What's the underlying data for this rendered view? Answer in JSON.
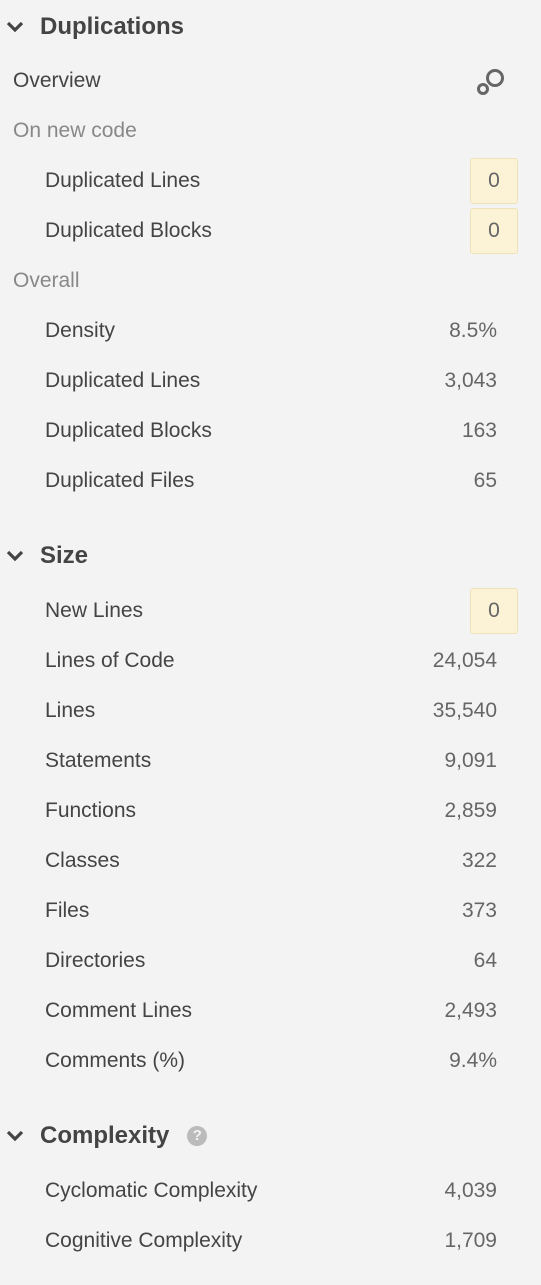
{
  "duplications": {
    "title": "Duplications",
    "overview": "Overview",
    "on_new_code": "On new code",
    "new_items": [
      {
        "label": "Duplicated Lines",
        "value": "0"
      },
      {
        "label": "Duplicated Blocks",
        "value": "0"
      }
    ],
    "overall": "Overall",
    "overall_items": [
      {
        "label": "Density",
        "value": "8.5%"
      },
      {
        "label": "Duplicated Lines",
        "value": "3,043"
      },
      {
        "label": "Duplicated Blocks",
        "value": "163"
      },
      {
        "label": "Duplicated Files",
        "value": "65"
      }
    ]
  },
  "size": {
    "title": "Size",
    "new_lines": {
      "label": "New Lines",
      "value": "0"
    },
    "items": [
      {
        "label": "Lines of Code",
        "value": "24,054"
      },
      {
        "label": "Lines",
        "value": "35,540"
      },
      {
        "label": "Statements",
        "value": "9,091"
      },
      {
        "label": "Functions",
        "value": "2,859"
      },
      {
        "label": "Classes",
        "value": "322"
      },
      {
        "label": "Files",
        "value": "373"
      },
      {
        "label": "Directories",
        "value": "64"
      },
      {
        "label": "Comment Lines",
        "value": "2,493"
      },
      {
        "label": "Comments (%)",
        "value": "9.4%"
      }
    ]
  },
  "complexity": {
    "title": "Complexity",
    "help": "?",
    "items": [
      {
        "label": "Cyclomatic Complexity",
        "value": "4,039"
      },
      {
        "label": "Cognitive Complexity",
        "value": "1,709"
      }
    ]
  }
}
